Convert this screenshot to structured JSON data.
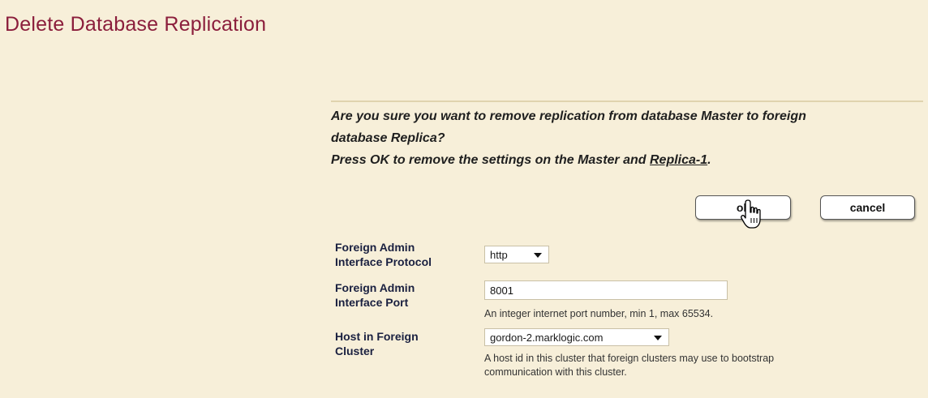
{
  "page": {
    "title": "Delete Database Replication"
  },
  "confirm": {
    "line1": "Are you sure you want to remove replication from database Master to foreign",
    "line2": "database Replica?",
    "line3_prefix": "Press OK to remove the settings on the Master and ",
    "line3_link": "Replica-1",
    "line3_suffix": "."
  },
  "buttons": {
    "ok_label": "ok",
    "cancel_label": "cancel"
  },
  "fields": {
    "protocol": {
      "label_line1": "Foreign Admin",
      "label_line2": "Interface Protocol",
      "value": "http"
    },
    "port": {
      "label_line1": "Foreign Admin",
      "label_line2": "Interface Port",
      "value": "8001",
      "hint": "An integer internet port number, min 1, max 65534."
    },
    "host": {
      "label_line1": "Host in Foreign",
      "label_line2": "Cluster",
      "value": "gordon-2.marklogic.com",
      "hint_line1": "A host id in this cluster that foreign clusters may use to bootstrap",
      "hint_line2": "communication with this cluster."
    }
  },
  "icons": {
    "cursor": "hand-pointer-icon"
  },
  "colors": {
    "background": "#f7efd9",
    "title": "#8b1e3c",
    "label": "#1a2040"
  }
}
